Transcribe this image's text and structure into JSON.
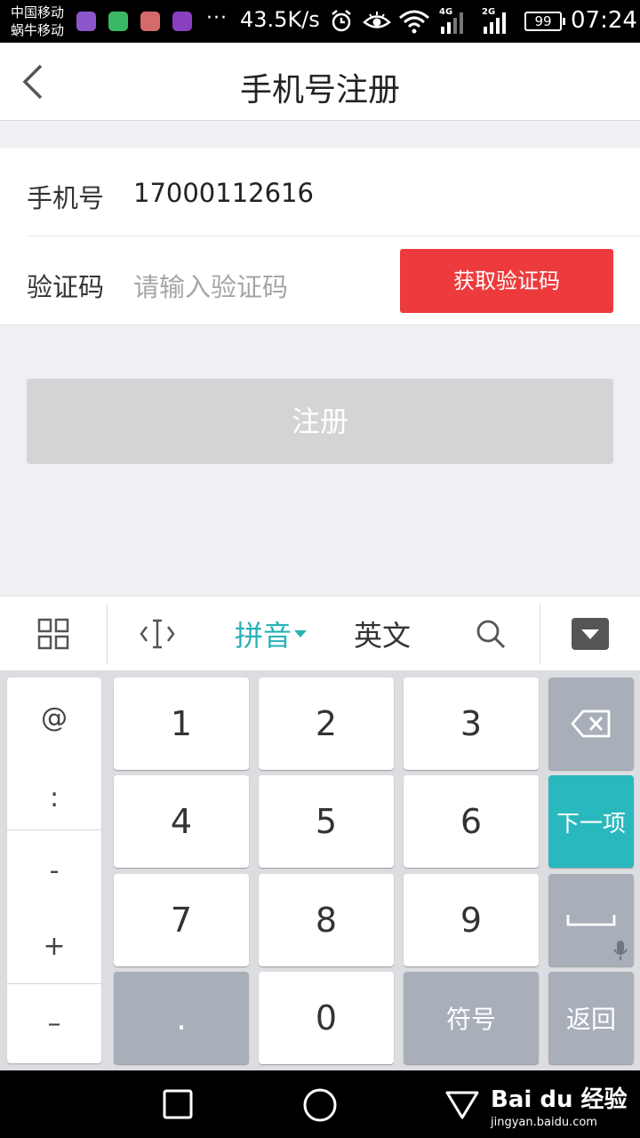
{
  "status_bar": {
    "carrier_1": "中国移动",
    "carrier_2": "蜗牛移动",
    "more": "···",
    "net_speed": "43.5K/s",
    "sig1": "4G",
    "sig2": "2G",
    "battery": "99",
    "time": "07:24"
  },
  "nav": {
    "title": "手机号注册"
  },
  "form": {
    "phone_label": "手机号",
    "phone_value": "17000112616",
    "code_label": "验证码",
    "code_placeholder": "请输入验证码",
    "get_code_button": "获取验证码"
  },
  "register_button": "注册",
  "keyboard": {
    "toolbar": {
      "pinyin": "拼音",
      "english": "英文"
    },
    "side_symbols": [
      "@",
      ":",
      "-",
      "+",
      "–"
    ],
    "digits": [
      "1",
      "2",
      "3",
      "4",
      "5",
      "6",
      "7",
      "8",
      "9"
    ],
    "dot": ".",
    "zero": "0",
    "symbols_key": "符号",
    "next_key": "下一项",
    "return_key": "返回"
  },
  "watermark": {
    "logo": "Bai du 经验",
    "sub": "jingyan.baidu.com"
  }
}
